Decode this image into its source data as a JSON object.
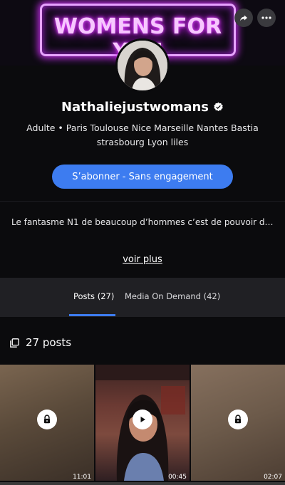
{
  "banner": {
    "neon_text": "WOMENS FOR YOU"
  },
  "profile": {
    "name": "Nathaliejustwomans",
    "description_line1": "Adulte • Paris Toulouse Nice Marseille Nantes Bastia",
    "description_line2": "strasbourg Lyon liles",
    "subscribe_label": "S’abonner - Sans engagement",
    "bio": "Le fantasme N1 de beaucoup d’hommes c’est de pouvoir d…",
    "see_more": "voir plus"
  },
  "tabs": [
    {
      "label": "Posts (27)",
      "active": true
    },
    {
      "label": "Media On Demand (42)",
      "active": false
    }
  ],
  "posts": {
    "count_label": "27 posts",
    "tiles": [
      {
        "type": "locked",
        "icon": "lock-icon",
        "duration": "11:01"
      },
      {
        "type": "video",
        "icon": "play-icon",
        "duration": "00:45"
      },
      {
        "type": "locked",
        "icon": "lock-icon",
        "duration": "02:07"
      }
    ]
  },
  "colors": {
    "accent": "#3d7cf0",
    "background": "#0b0b0d",
    "neon": "#e14cff"
  }
}
